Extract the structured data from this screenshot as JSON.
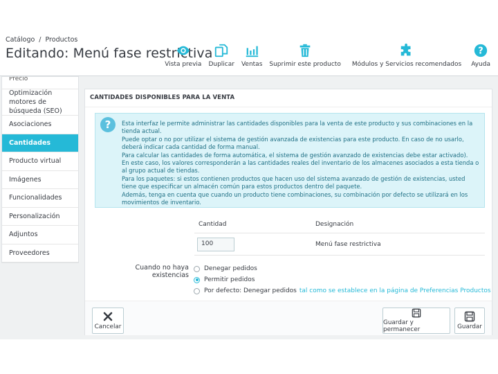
{
  "header": {
    "breadcrumb": [
      "Catálogo",
      "/",
      "Productos"
    ],
    "title": "Editando: Menú fase restrictiva"
  },
  "toolbar": {
    "preview": "Vista previa",
    "duplicate": "Duplicar",
    "sales": "Ventas",
    "delete": "Suprimir este producto",
    "modules": "Módulos y Servicios recomendados",
    "help": "Ayuda"
  },
  "sidebar": {
    "cut_label": "Precio",
    "items": [
      "Optimización motores de búsqueda (SEO)",
      "Asociaciones",
      "Cantidades",
      "Producto virtual",
      "Imágenes",
      "Funcionalidades",
      "Personalización",
      "Adjuntos",
      "Proveedores"
    ]
  },
  "panel": {
    "title": "CANTIDADES DISPONIBLES PARA LA VENTA",
    "alert_icon": "?",
    "alert_lines": [
      "Esta interfaz le permite administrar las cantidades disponibles para la venta de este producto y sus combinaciones en la tienda actual.",
      "Puede optar o no por utilizar el sistema de gestión avanzada de existencias para este producto. En caso de no usarlo, deberá indicar cada cantidad de forma manual.",
      "Para calcular las cantidades de forma automática, el sistema de gestión avanzado de existencias debe estar activado).",
      "En este caso, los valores corresponderán a las cantidades reales del inventario de los almacenes asociados a esta tienda o al grupo actual de tiendas.",
      "Para los paquetes: si estos contienen productos que hacen uso del sistema avanzado de gestión de existencias, usted tiene que especificar un almacén común para estos productos dentro del paquete.",
      "Además, tenga en cuenta que cuando un producto tiene combinaciones, su combinación por defecto se utilizará en los movimientos de inventario."
    ],
    "table": {
      "headers": [
        "Cantidad",
        "Designación"
      ],
      "quantity": "100",
      "designation": "Menú fase restrictiva"
    },
    "stock_label": "Cuando no haya existencias",
    "options": [
      {
        "label": "Denegar pedidos",
        "checked": false
      },
      {
        "label": "Permitir pedidos",
        "checked": true
      },
      {
        "label": "Por defecto: Denegar pedidos",
        "checked": false,
        "link": "tal como se establece en la página de Preferencias Productos"
      }
    ],
    "buttons": {
      "cancel": "Cancelar",
      "save_stay": "Guardar y permanecer",
      "save": "Guardar"
    }
  },
  "colors": {
    "accent": "#25b9d7",
    "alert_bg": "#dcf4f9",
    "alert_text": "#1e6f84"
  }
}
